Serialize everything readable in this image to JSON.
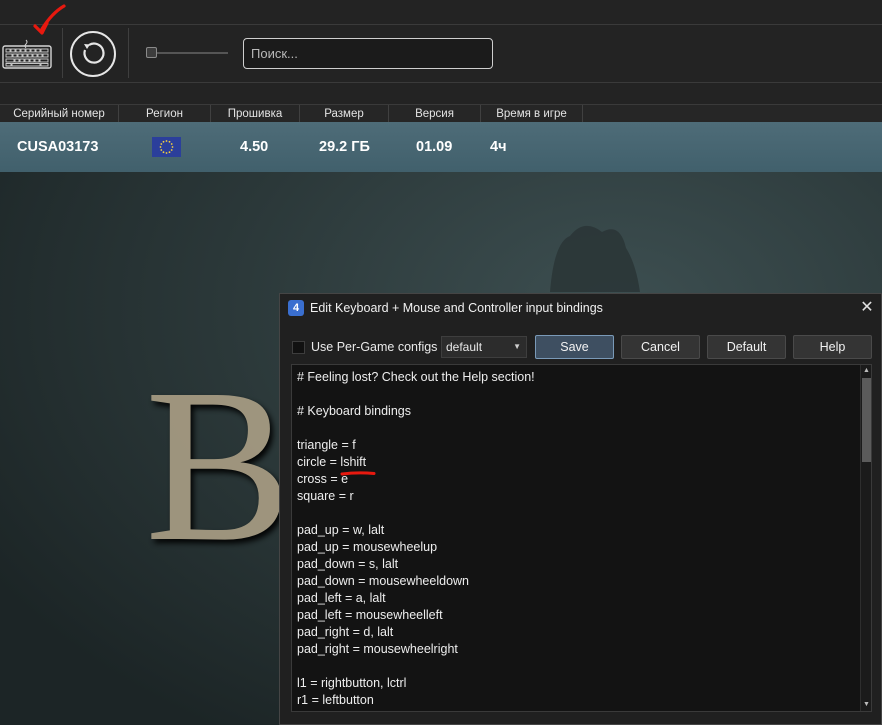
{
  "toolbar": {
    "search_placeholder": "Поиск...",
    "icons": [
      "keyboard-icon",
      "refresh-icon"
    ]
  },
  "table": {
    "headers": [
      "Серийный номер",
      "Регион",
      "Прошивка",
      "Размер",
      "Версия",
      "Время в игре"
    ],
    "row": {
      "serial": "CUSA03173",
      "region_icon": "eu-flag-icon",
      "firmware": "4.50",
      "size": "29.2 ГБ",
      "version": "01.09",
      "playtime": "4ч"
    }
  },
  "background": {
    "letter": "B"
  },
  "dialog": {
    "title": "Edit Keyboard + Mouse and Controller input bindings",
    "per_game_label": "Use Per-Game configs",
    "per_game_checked": false,
    "config_selected": "default",
    "buttons": {
      "save": "Save",
      "cancel": "Cancel",
      "default": "Default",
      "help": "Help"
    },
    "editor_lines": [
      "# Feeling lost? Check out the Help section!",
      "",
      "# Keyboard bindings",
      "",
      "triangle = f",
      "circle = lshift",
      "cross = e",
      "square = r",
      "",
      "pad_up = w, lalt",
      "pad_up = mousewheelup",
      "pad_down = s, lalt",
      "pad_down = mousewheeldown",
      "pad_left = a, lalt",
      "pad_left = mousewheelleft",
      "pad_right = d, lalt",
      "pad_right = mousewheelright",
      "",
      "l1 = rightbutton, lctrl",
      "r1 = leftbutton"
    ]
  },
  "colors": {
    "annotation": "#e8190f",
    "row_bg": "#46636f",
    "primary_border": "#7a9ab8"
  }
}
